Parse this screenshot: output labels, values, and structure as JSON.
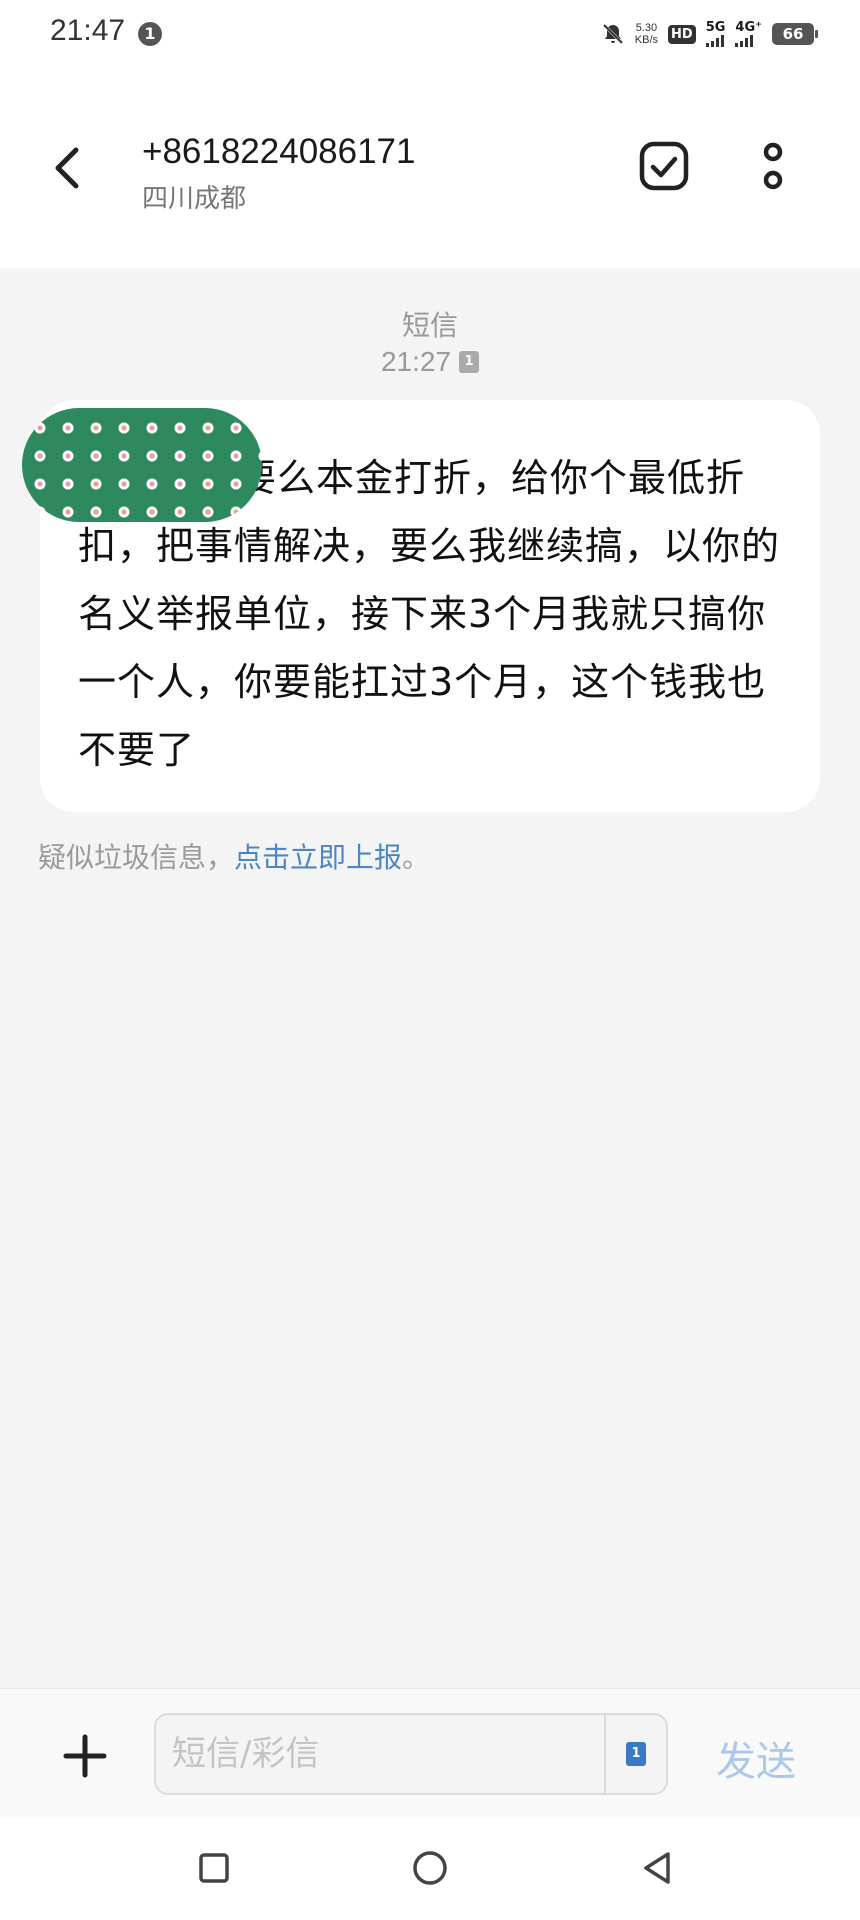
{
  "status_bar": {
    "time": "21:47",
    "notification_badge": "1",
    "net_speed_value": "5.30",
    "net_speed_unit": "KB/s",
    "hd_label": "HD",
    "sim1_label": "5G",
    "sim2_label": "4G⁺",
    "battery": "66"
  },
  "header": {
    "number": "+8618224086171",
    "location": "四川成都"
  },
  "conversation": {
    "message_type": "短信",
    "timestamp": "21:27",
    "sim_badge": "1",
    "message_text": "要么本金打折，给你个最低折扣，把事情解决，要么我继续搞，以你的名义举报单位，接下来3个月我就只搞你一个人，你要能扛过3个月，这个钱我也不要了",
    "spam_notice_prefix": "疑似垃圾信息，",
    "spam_notice_link": "点击立即上报",
    "spam_notice_suffix": "。"
  },
  "composer": {
    "placeholder": "短信/彩信",
    "sim_badge": "1",
    "send_label": "发送"
  },
  "colors": {
    "link": "#4d86c6",
    "send_disabled": "#a9c8eb",
    "redaction_green": "#2e8a5e"
  },
  "icons": [
    "back-icon",
    "select-check-icon",
    "more-vertical-icon",
    "plus-icon",
    "sim-card-icon",
    "nav-recent-icon",
    "nav-home-icon",
    "nav-back-icon"
  ]
}
